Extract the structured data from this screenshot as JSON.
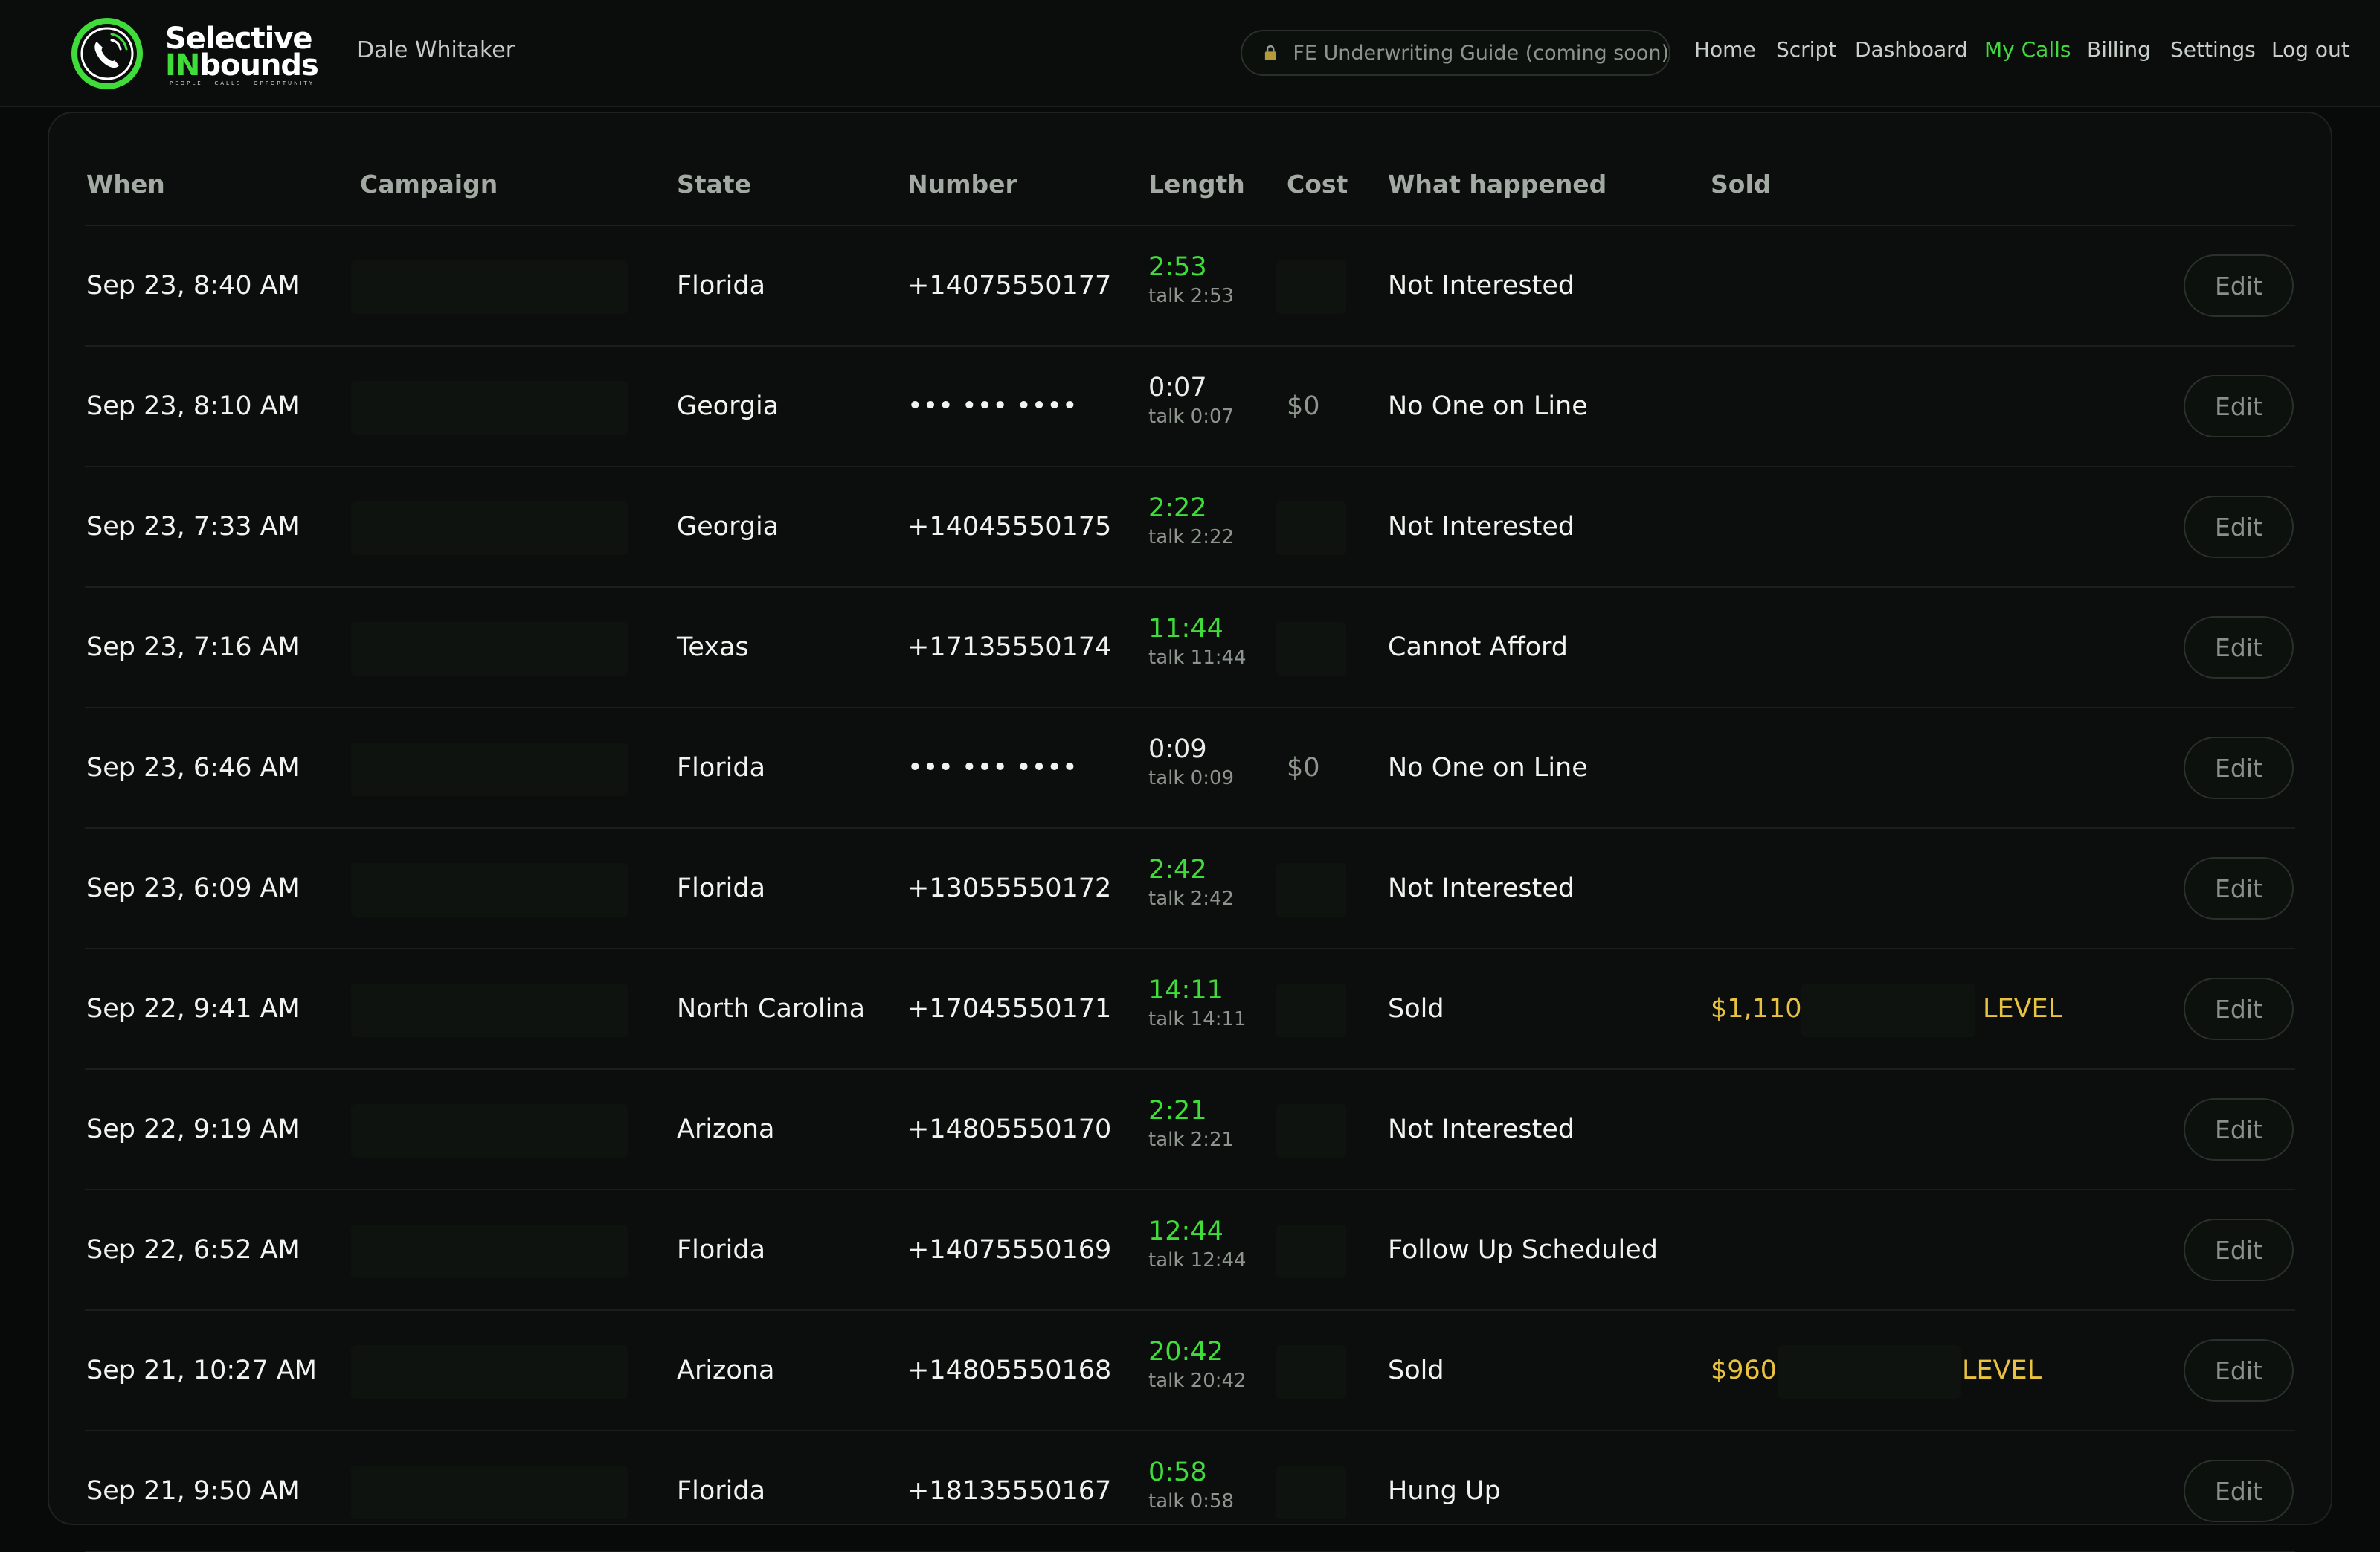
{
  "brand": {
    "line1": "Selective",
    "line2_highlight": "IN",
    "line2_rest": "bounds",
    "tagline": "PEOPLE · CALLS · OPPORTUNITY",
    "accent_color": "#3fdc3a",
    "icon": "phone-ring-logo-icon"
  },
  "user": {
    "name": "Dale Whitaker"
  },
  "guide": {
    "label": "FE Underwriting Guide (coming soon)",
    "icon": "lock-icon"
  },
  "nav": {
    "items": [
      {
        "label": "Home"
      },
      {
        "label": "Script"
      },
      {
        "label": "Dashboard"
      },
      {
        "label": "My Calls",
        "active": true
      },
      {
        "label": "Billing"
      },
      {
        "label": "Settings"
      },
      {
        "label": "Log out"
      }
    ]
  },
  "table": {
    "headers": {
      "when": "When",
      "campaign": "Campaign",
      "state": "State",
      "number": "Number",
      "length": "Length",
      "cost": "Cost",
      "outcome": "What happened",
      "sold": "Sold"
    },
    "edit_label": "Edit",
    "rows": [
      {
        "when": "Sep 23, 8:40 AM",
        "state": "Florida",
        "number": "+14075550177",
        "length": "2:53",
        "talk": "talk 2:53",
        "cost": "",
        "outcome": "Not Interested",
        "sold_amount": "",
        "sold_level": ""
      },
      {
        "when": "Sep 23, 8:10 AM",
        "state": "Georgia",
        "number": "••• ••• ••••",
        "length": "0:07",
        "talk": "talk 0:07",
        "cost": "$0",
        "outcome": "No One on Line",
        "sold_amount": "",
        "sold_level": ""
      },
      {
        "when": "Sep 23, 7:33 AM",
        "state": "Georgia",
        "number": "+14045550175",
        "length": "2:22",
        "talk": "talk 2:22",
        "cost": "",
        "outcome": "Not Interested",
        "sold_amount": "",
        "sold_level": ""
      },
      {
        "when": "Sep 23, 7:16 AM",
        "state": "Texas",
        "number": "+17135550174",
        "length": "11:44",
        "talk": "talk 11:44",
        "cost": "",
        "outcome": "Cannot Afford",
        "sold_amount": "",
        "sold_level": ""
      },
      {
        "when": "Sep 23, 6:46 AM",
        "state": "Florida",
        "number": "••• ••• ••••",
        "length": "0:09",
        "talk": "talk 0:09",
        "cost": "$0",
        "outcome": "No One on Line",
        "sold_amount": "",
        "sold_level": ""
      },
      {
        "when": "Sep 23, 6:09 AM",
        "state": "Florida",
        "number": "+13055550172",
        "length": "2:42",
        "talk": "talk 2:42",
        "cost": "",
        "outcome": "Not Interested",
        "sold_amount": "",
        "sold_level": ""
      },
      {
        "when": "Sep 22, 9:41 AM",
        "state": "North Carolina",
        "number": "+17045550171",
        "length": "14:11",
        "talk": "talk 14:11",
        "cost": "",
        "outcome": "Sold",
        "sold_amount": "$1,110,",
        "sold_level": "LEVEL"
      },
      {
        "when": "Sep 22, 9:19 AM",
        "state": "Arizona",
        "number": "+14805550170",
        "length": "2:21",
        "talk": "talk 2:21",
        "cost": "",
        "outcome": "Not Interested",
        "sold_amount": "",
        "sold_level": ""
      },
      {
        "when": "Sep 22, 6:52 AM",
        "state": "Florida",
        "number": "+14075550169",
        "length": "12:44",
        "talk": "talk 12:44",
        "cost": "",
        "outcome": "Follow Up Scheduled",
        "sold_amount": "",
        "sold_level": ""
      },
      {
        "when": "Sep 21, 10:27 AM",
        "state": "Arizona",
        "number": "+14805550168",
        "length": "20:42",
        "talk": "talk 20:42",
        "cost": "",
        "outcome": "Sold",
        "sold_amount": "$960,",
        "sold_level": "LEVEL"
      },
      {
        "when": "Sep 21, 9:50 AM",
        "state": "Florida",
        "number": "+18135550167",
        "length": "0:58",
        "talk": "talk 0:58",
        "cost": "",
        "outcome": "Hung Up",
        "sold_amount": "",
        "sold_level": ""
      }
    ]
  }
}
